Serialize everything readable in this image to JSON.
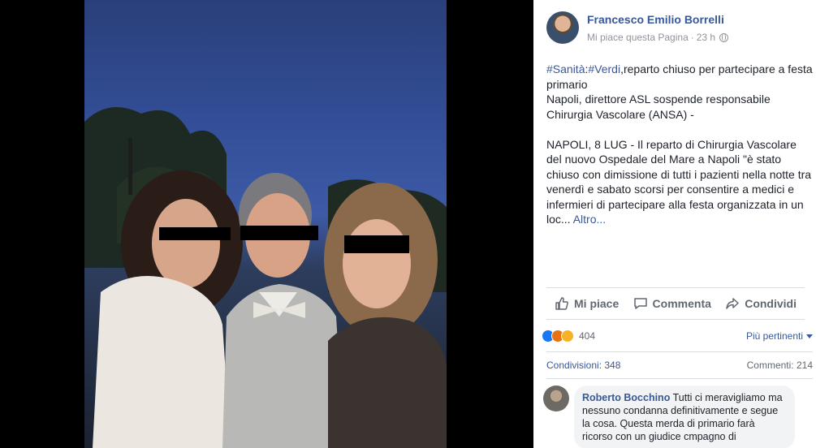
{
  "post": {
    "author": "Francesco Emilio Borrelli",
    "page_like": "Mi piace questa Pagina",
    "separator": "·",
    "time": "23 h",
    "privacy_icon": "globe-icon",
    "hashtag1": "#Sanità",
    "colon": ":",
    "hashtag2": "#Verdi",
    "line1_rest": ",reparto chiuso per partecipare a festa",
    "line2": "primario",
    "line3": "Napoli, direttore ASL sospende responsabile",
    "line4": "Chirurgia Vascolare (ANSA) -",
    "para2": "NAPOLI, 8 LUG - Il reparto di Chirurgia Vascolare del nuovo Ospedale del Mare a Napoli \"è stato chiuso con dimissione di tutti i pazienti nella notte tra venerdì e sabato scorsi per consentire a medici e infermieri di partecipare alla festa organizzata in un loc...",
    "more": "Altro..."
  },
  "actions": {
    "like": "Mi piace",
    "comment": "Commenta",
    "share": "Condividi"
  },
  "reactions": {
    "count": "404",
    "sort": "Più pertinenti",
    "shares": "Condivisioni: 348",
    "comments": "Commenti: 214"
  },
  "comment": {
    "author": "Roberto Bocchino",
    "text": "Tutti ci meravigliamo ma nessuno condanna definitivamente e segue la cosa. Questa merda di primario farà ricorso con un giudice cmpagno di"
  },
  "colors": {
    "link": "#385898",
    "text": "#1d2129",
    "muted": "#90949c",
    "divider": "#dadde1"
  }
}
